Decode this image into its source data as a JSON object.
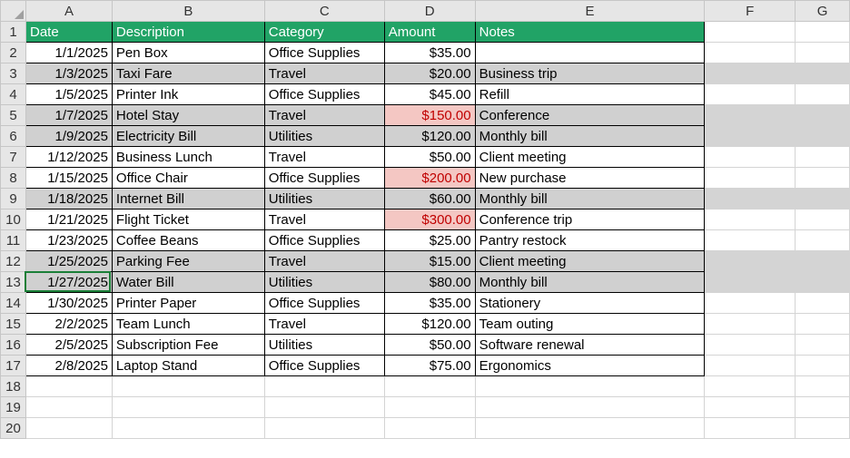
{
  "columns": [
    "A",
    "B",
    "C",
    "D",
    "E",
    "F",
    "G"
  ],
  "header": {
    "date": "Date",
    "description": "Description",
    "category": "Category",
    "amount": "Amount",
    "notes": "Notes"
  },
  "rows": [
    {
      "n": 2,
      "date": "1/1/2025",
      "desc": "Pen Box",
      "cat": "Office Supplies",
      "amt": "$35.00",
      "notes": "",
      "band": false,
      "hl": false
    },
    {
      "n": 3,
      "date": "1/3/2025",
      "desc": "Taxi Fare",
      "cat": "Travel",
      "amt": "$20.00",
      "notes": "Business trip",
      "band": true,
      "hl": false
    },
    {
      "n": 4,
      "date": "1/5/2025",
      "desc": "Printer Ink",
      "cat": "Office Supplies",
      "amt": "$45.00",
      "notes": "Refill",
      "band": false,
      "hl": false
    },
    {
      "n": 5,
      "date": "1/7/2025",
      "desc": "Hotel Stay",
      "cat": "Travel",
      "amt": "$150.00",
      "notes": "Conference",
      "band": true,
      "hl": true
    },
    {
      "n": 6,
      "date": "1/9/2025",
      "desc": "Electricity Bill",
      "cat": "Utilities",
      "amt": "$120.00",
      "notes": "Monthly bill",
      "band": true,
      "hl": false
    },
    {
      "n": 7,
      "date": "1/12/2025",
      "desc": "Business Lunch",
      "cat": "Travel",
      "amt": "$50.00",
      "notes": "Client meeting",
      "band": false,
      "hl": false
    },
    {
      "n": 8,
      "date": "1/15/2025",
      "desc": "Office Chair",
      "cat": "Office Supplies",
      "amt": "$200.00",
      "notes": "New purchase",
      "band": false,
      "hl": true
    },
    {
      "n": 9,
      "date": "1/18/2025",
      "desc": "Internet Bill",
      "cat": "Utilities",
      "amt": "$60.00",
      "notes": "Monthly bill",
      "band": true,
      "hl": false
    },
    {
      "n": 10,
      "date": "1/21/2025",
      "desc": "Flight Ticket",
      "cat": "Travel",
      "amt": "$300.00",
      "notes": "Conference trip",
      "band": false,
      "hl": true
    },
    {
      "n": 11,
      "date": "1/23/2025",
      "desc": "Coffee Beans",
      "cat": "Office Supplies",
      "amt": "$25.00",
      "notes": "Pantry restock",
      "band": false,
      "hl": false
    },
    {
      "n": 12,
      "date": "1/25/2025",
      "desc": "Parking Fee",
      "cat": "Travel",
      "amt": "$15.00",
      "notes": "Client meeting",
      "band": true,
      "hl": false
    },
    {
      "n": 13,
      "date": "1/27/2025",
      "desc": "Water Bill",
      "cat": "Utilities",
      "amt": "$80.00",
      "notes": "Monthly bill",
      "band": true,
      "hl": false
    },
    {
      "n": 14,
      "date": "1/30/2025",
      "desc": "Printer Paper",
      "cat": "Office Supplies",
      "amt": "$35.00",
      "notes": "Stationery",
      "band": false,
      "hl": false
    },
    {
      "n": 15,
      "date": "2/2/2025",
      "desc": "Team Lunch",
      "cat": "Travel",
      "amt": "$120.00",
      "notes": "Team outing",
      "band": false,
      "hl": false
    },
    {
      "n": 16,
      "date": "2/5/2025",
      "desc": "Subscription Fee",
      "cat": "Utilities",
      "amt": "$50.00",
      "notes": "Software renewal",
      "band": false,
      "hl": false
    },
    {
      "n": 17,
      "date": "2/8/2025",
      "desc": "Laptop Stand",
      "cat": "Office Supplies",
      "amt": "$75.00",
      "notes": "Ergonomics",
      "band": false,
      "hl": false
    }
  ],
  "empty_rows": [
    18,
    19,
    20
  ],
  "active_cell": "A13"
}
